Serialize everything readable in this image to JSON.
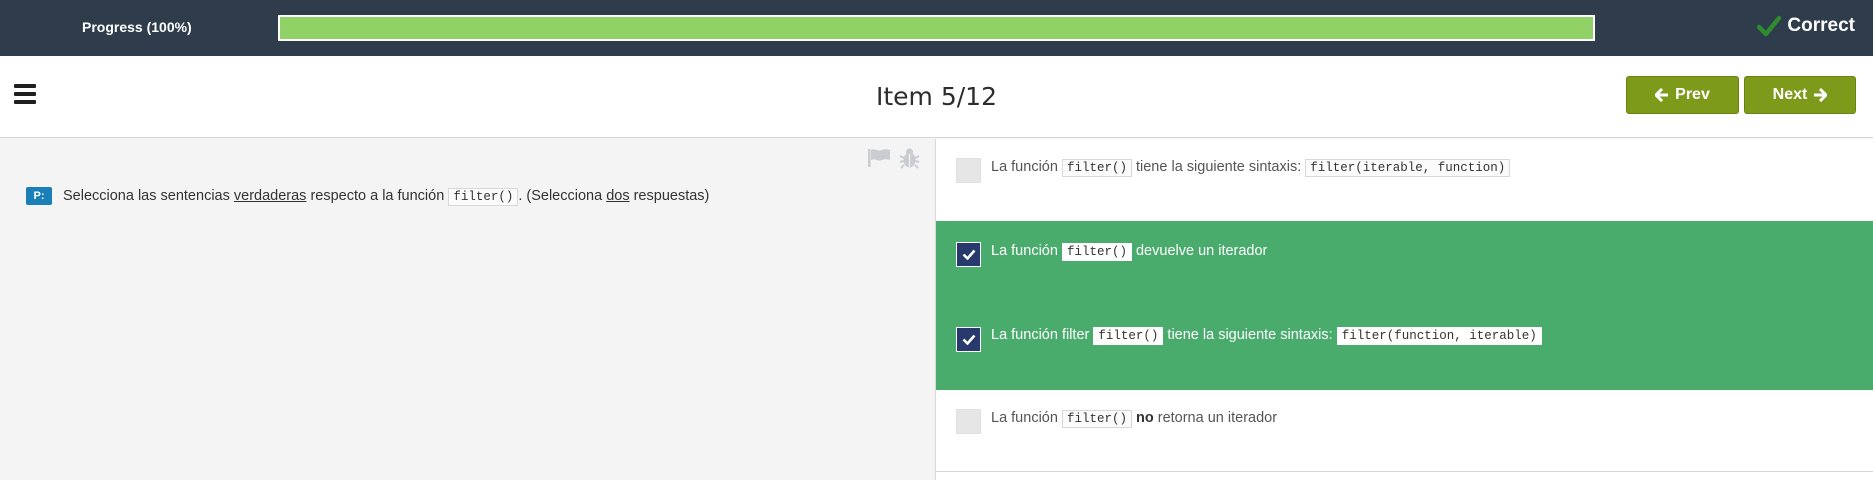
{
  "progress": {
    "label": "Progress (100%)",
    "value_fraction": 1.0,
    "fill_color": "#91d266"
  },
  "status": {
    "label": "Correct",
    "icon": "check-icon",
    "icon_color": "#2e8b2e"
  },
  "header": {
    "menu_icon": "hamburger-menu-icon",
    "title": "Item 5/12",
    "prev_label": "Prev",
    "next_label": "Next",
    "button_color": "#7e9a1b"
  },
  "question": {
    "badge": "P:",
    "text_before": "Selecciona las sentencias ",
    "underlined_1": "verdaderas",
    "text_middle": " respecto a la función ",
    "code": "filter()",
    "text_after": ". (Selecciona ",
    "underlined_2": "dos",
    "text_end": " respuestas)",
    "flag_icon": "flag-icon",
    "bug_icon": "bug-icon"
  },
  "options": [
    {
      "checked": false,
      "text_1": "La función ",
      "code_1": "filter()",
      "text_2": " tiene la siguiente sintaxis: ",
      "code_2": "filter(iterable, function)"
    },
    {
      "checked": true,
      "text_1": "La función ",
      "code_1": "filter()",
      "text_2": " devuelve un iterador"
    },
    {
      "checked": true,
      "text_1": "La función filter ",
      "code_1": "filter()",
      "text_2": " tiene la siguiente sintaxis: ",
      "code_2": "filter(function, iterable)"
    },
    {
      "checked": false,
      "text_1": "La función ",
      "code_1": "filter()",
      "text_2_bold": "no",
      "text_3": " retorna un iterador"
    }
  ],
  "colors": {
    "correct_option_bg": "#49ac6d",
    "checkbox_checked": "#283a6d",
    "topbar": "#2f3c4b"
  }
}
